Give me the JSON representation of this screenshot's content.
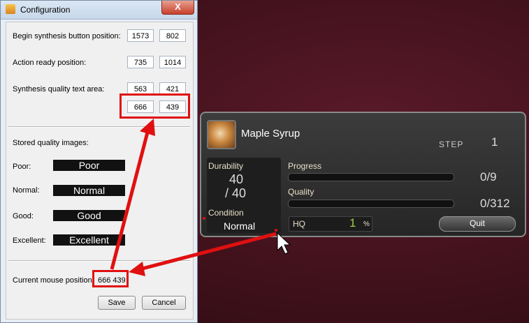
{
  "window": {
    "title": "Configuration",
    "close": "X"
  },
  "fields": {
    "begin_label": "Begin synthesis button position:",
    "begin_x": "1573",
    "begin_y": "802",
    "action_label": "Action ready position:",
    "action_x": "735",
    "action_y": "1014",
    "quality_label": "Synthesis quality text area:",
    "quality_x1": "563",
    "quality_y1": "421",
    "quality_x2": "666",
    "quality_y2": "439"
  },
  "stored": {
    "heading": "Stored quality images:",
    "items": [
      {
        "label": "Poor:",
        "image_text": "Poor"
      },
      {
        "label": "Normal:",
        "image_text": "Normal"
      },
      {
        "label": "Good:",
        "image_text": "Good"
      },
      {
        "label": "Excellent:",
        "image_text": "Excellent"
      }
    ]
  },
  "mouse": {
    "label": "Current mouse position:",
    "value": "666 439"
  },
  "buttons": {
    "save": "Save",
    "cancel": "Cancel"
  },
  "game": {
    "item_name": "Maple Syrup",
    "step_label": "STEP",
    "step_value": "1",
    "durability_label": "Durability",
    "durability_current": "40",
    "durability_max": "/ 40",
    "condition_label": "Condition",
    "condition_value": "Normal",
    "progress_label": "Progress",
    "progress_value": "0/9",
    "quality_label": "Quality",
    "quality_value": "0/312",
    "hq_label": "HQ",
    "hq_value": "1",
    "hq_unit": "%",
    "quit_label": "Quit"
  },
  "colors": {
    "annotation": "#e01010",
    "title_bar": "#c6d7ea",
    "game_panel": "#2e2e2e"
  }
}
